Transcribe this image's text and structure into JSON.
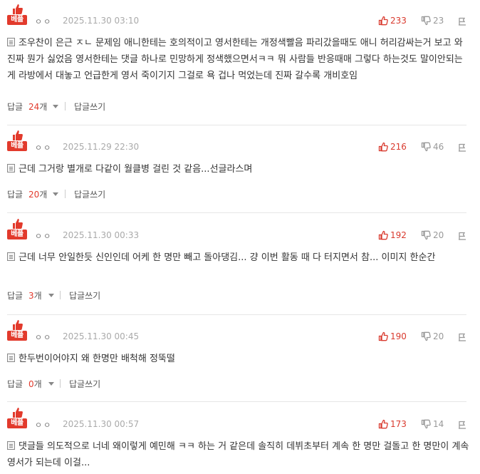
{
  "ui": {
    "best_label": "베플",
    "reply_label": "답글",
    "write_label": "답글쓰기",
    "count_suffix": "개"
  },
  "colors": {
    "accent": "#e23a2c",
    "muted": "#999999"
  },
  "comments": [
    {
      "user": "ㅇㅇ",
      "date": "2025.11.30 03:10",
      "likes": "233",
      "dislikes": "23",
      "body": "조우찬이 은근 ㅈㄴ 문제임 애니한테는 호의적이고 영서한테는 개정색빨음 파리갔을때도 애니 허리감싸는거 보고 와 진짜 뭔가 싫었음 영서한테는 댓글 하나로 민망하게 정색했으면서ㅋㅋ 뭐 사람들 반응때매 그렇다 하는것도 말이안되는게 라방에서 대놓고 언급한게 영서 죽이기지 그걸로 욕 겁나 먹었는데 진짜 갈수록 개비호임",
      "replies": "24"
    },
    {
      "user": "ㅇㅇ",
      "date": "2025.11.29 22:30",
      "likes": "216",
      "dislikes": "46",
      "body": "근데 그거랑 별개로 다같이 월클병 걸린 것 같음...선글라스며",
      "replies": "20"
    },
    {
      "user": "ㅇㅇ",
      "date": "2025.11.30 00:33",
      "likes": "192",
      "dislikes": "20",
      "body": "근데 너무 안일한듯 신인인데 어케 한 명만 빼고 돌아댕김... 걍 이번 활동 때 다 터지면서 참... 이미지 한순간",
      "replies": "3"
    },
    {
      "user": "ㅇㅇ",
      "date": "2025.11.30 00:45",
      "likes": "190",
      "dislikes": "20",
      "body": "한두번이어야지 왜 한명만 배척해 정뚝떨",
      "replies": "0"
    },
    {
      "user": "ㅇㅇ",
      "date": "2025.11.30 00:57",
      "likes": "173",
      "dislikes": "14",
      "body": "댓글들 의도적으로 너네 왜이렇게 예민해 ㅋㅋ 하는 거 같은데 솔직히 데뷔초부터 계속 한 명만 걸돌고 한 명만이 계속 영서가 되는데 이걸...",
      "replies": ""
    }
  ]
}
